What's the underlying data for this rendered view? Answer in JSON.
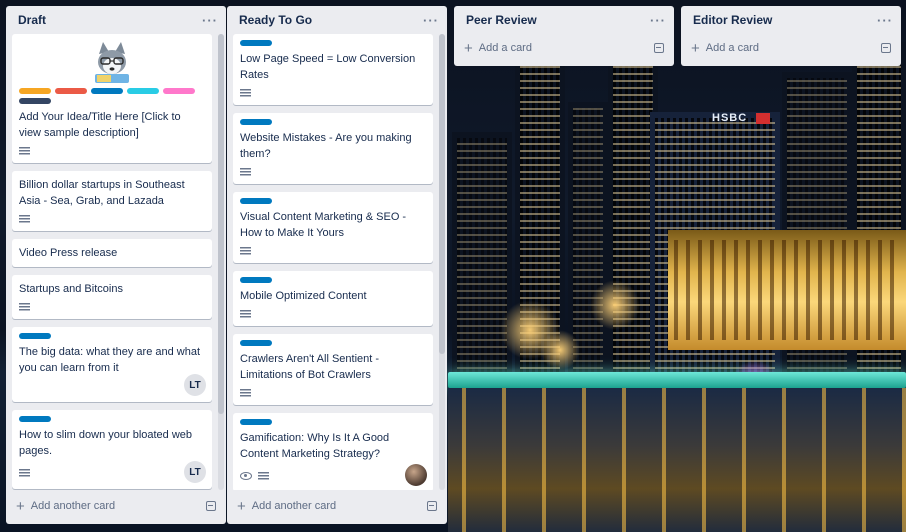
{
  "board": {
    "background_sign": "HSBC",
    "lists": [
      {
        "title": "Draft",
        "menu": "···",
        "add_label": "Add another card",
        "cards": [
          {
            "cover": "husky-illustration",
            "labels": [
              "#f6a623",
              "#eb5a46",
              "#0079bf",
              "#29cce5",
              "#ff78cb",
              "#344563"
            ],
            "title": "Add Your Idea/Title Here [Click to view sample description]",
            "description": true
          },
          {
            "title": "Billion dollar startups in Southeast Asia - Sea, Grab, and Lazada",
            "description": true
          },
          {
            "title": "Video Press release"
          },
          {
            "title": "Startups and Bitcoins",
            "description": true
          },
          {
            "labels": [
              "#0079bf"
            ],
            "title": "The big data: what they are and what you can learn from it",
            "member": "LT"
          },
          {
            "labels": [
              "#0079bf"
            ],
            "title": "How to slim down your bloated web pages.",
            "description": true,
            "member": "LT"
          }
        ]
      },
      {
        "title": "Ready To Go",
        "menu": "···",
        "add_label": "Add another card",
        "cards": [
          {
            "labels": [
              "#0079bf"
            ],
            "title": "Low Page Speed = Low Conversion Rates",
            "description": true
          },
          {
            "labels": [
              "#0079bf"
            ],
            "title": "Website Mistakes - Are you making them?",
            "description": true
          },
          {
            "labels": [
              "#0079bf"
            ],
            "title": "Visual Content Marketing & SEO - How to Make It Yours",
            "description": true
          },
          {
            "labels": [
              "#0079bf"
            ],
            "title": "Mobile Optimized Content",
            "description": true
          },
          {
            "labels": [
              "#0079bf"
            ],
            "title": "Crawlers Aren't All Sentient - Limitations of Bot Crawlers",
            "description": true
          },
          {
            "labels": [
              "#0079bf"
            ],
            "title": "Gamification: Why Is It A Good Content Marketing Strategy?",
            "watch": true,
            "description": true,
            "member_photo": true
          }
        ]
      },
      {
        "title": "Peer Review",
        "menu": "···",
        "add_label": "Add a card",
        "cards": []
      },
      {
        "title": "Editor Review",
        "menu": "···",
        "add_label": "Add a card",
        "cards": []
      }
    ]
  },
  "colors": {
    "list_bg": "#ebecf0",
    "label_blue": "#0079bf",
    "text": "#172b4d"
  }
}
